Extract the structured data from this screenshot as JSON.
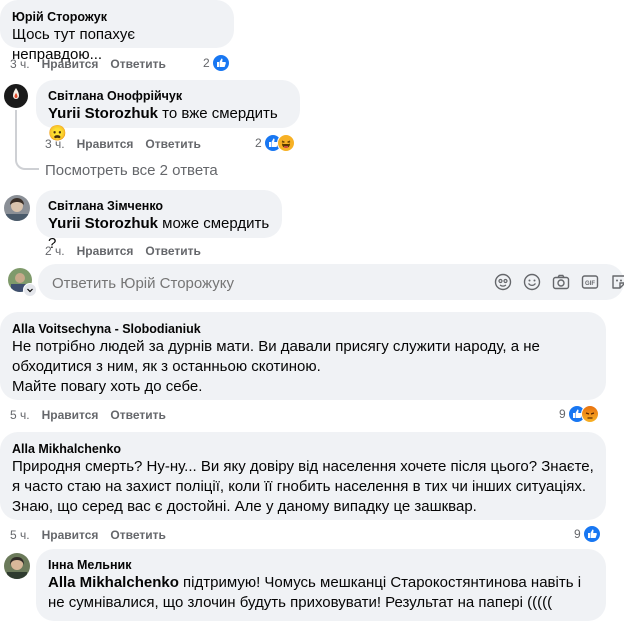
{
  "comments": [
    {
      "author": "Юрій Сторожук",
      "text": "Щось тут попахує неправдою...",
      "time": "3 ч.",
      "like": "Нравится",
      "reply": "Ответить",
      "count": "2"
    },
    {
      "author": "Світлана Онофрійчук",
      "mention": "Yurii Storozhuk",
      "text": " то вже смердить 😦",
      "time": "3 ч.",
      "like": "Нравится",
      "reply": "Ответить",
      "count": "2"
    },
    {
      "view_replies": "Посмотреть все 2 ответа"
    },
    {
      "author": "Світлана Зімченко",
      "mention": "Yurii Storozhuk",
      "text": " може смердить ?",
      "time": "2 ч.",
      "like": "Нравится",
      "reply": "Ответить"
    },
    {
      "author": "Alla Voitsechyna - Slobodianiuk",
      "text": "Не потрібно людей за дурнів мати. Ви давали присягу служити народу, а не обходитися з ним, як з останньою скотиною.\nМайте повагу хоть до себе.",
      "time": "5 ч.",
      "like": "Нравится",
      "reply": "Ответить",
      "count": "9"
    },
    {
      "author": "Alla Mikhalchenko",
      "text": "Природня смерть? Ну-ну... Ви яку довіру від населення хочете після цього? Знаєте, я часто стаю на захист поліції, коли її гнобить населення в тих чи інших ситуаціях. Знаю, що серед вас є достойні. Але у даному випадку це зашквар.",
      "time": "5 ч.",
      "like": "Нравится",
      "reply": "Ответить",
      "count": "9"
    },
    {
      "author": "Інна Мельник",
      "mention": "Alla Mikhalchenko",
      "text": " підтримую! Чомусь мешканці Старокостянтинова навіть і не сумнівалися, що злочин будуть приховувати! Результат на папері ((((("
    }
  ],
  "reply_placeholder": "Ответить Юрій Сторожуку",
  "colors": {
    "like": "#1877f2",
    "bubble": "#f0f2f5",
    "meta": "#65676b"
  }
}
